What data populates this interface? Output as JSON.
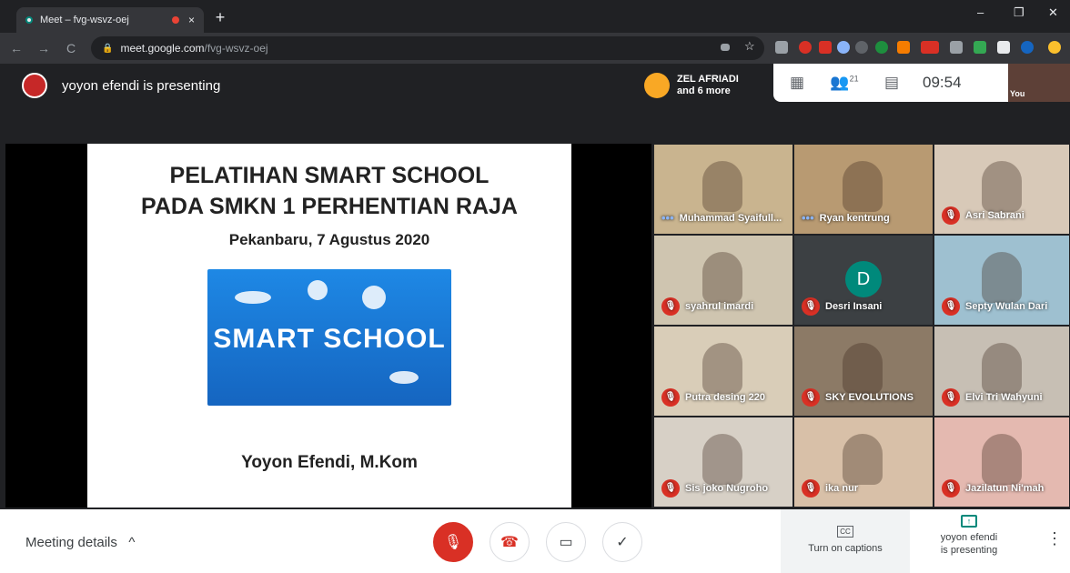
{
  "browser": {
    "tab_title": "Meet – fvg-wsvz-oej",
    "tab_close": "×",
    "new_tab": "+",
    "url_domain": "meet.google.com",
    "url_path": "/fvg-wsvz-oej",
    "back": "←",
    "forward": "→",
    "reload": "C",
    "minimize": "–",
    "maximize": "❐",
    "close": "✕"
  },
  "meet": {
    "presenter_text": "yoyon efendi is presenting",
    "speaker_name": "ZEL AFRIADI",
    "speaker_more": "and 6 more",
    "participant_count": "21",
    "time": "09:54",
    "self_label": "You",
    "slide": {
      "title_line1": "PELATIHAN SMART SCHOOL",
      "title_line2": "PADA SMKN 1 PERHENTIAN RAJA",
      "subtitle": "Pekanbaru, 7 Agustus 2020",
      "image_text": "SMART SCHOOL",
      "author": "Yoyon Efendi, M.Kom"
    },
    "participants": [
      {
        "name": "Muhammad Syaifull...",
        "state": "speaking",
        "bg": "#c9b48f"
      },
      {
        "name": "Ryan kentrung",
        "state": "speaking",
        "bg": "#b89a72"
      },
      {
        "name": "Asri Sabrani",
        "state": "muted",
        "bg": "#d8c9b8"
      },
      {
        "name": "syahrul imardi",
        "state": "muted",
        "bg": "#cfc5b0"
      },
      {
        "name": "Desri Insani",
        "state": "muted",
        "bg": "#3c4043",
        "initial": "D"
      },
      {
        "name": "Septy Wulan Dari",
        "state": "muted",
        "bg": "#9ec0d0"
      },
      {
        "name": "Putra desing 220",
        "state": "muted",
        "bg": "#d9cdb8"
      },
      {
        "name": "SKY EVOLUTIONS",
        "state": "muted",
        "bg": "#8c7a66"
      },
      {
        "name": "Elvi Tri Wahyuni",
        "state": "muted",
        "bg": "#c7bfb4"
      },
      {
        "name": "Sis joko Nugroho",
        "state": "muted",
        "bg": "#d7d0c6"
      },
      {
        "name": "ika nur",
        "state": "muted",
        "bg": "#d8c0a8"
      },
      {
        "name": "Jazilatun Ni'mah",
        "state": "muted",
        "bg": "#e4b9b0"
      }
    ]
  },
  "bottom": {
    "meeting_details": "Meeting details",
    "captions": "Turn on captions",
    "presenting_line1": "yoyon efendi",
    "presenting_line2": "is presenting"
  },
  "colors": {
    "mic_off": "#d93025",
    "accent": "#00897b"
  }
}
